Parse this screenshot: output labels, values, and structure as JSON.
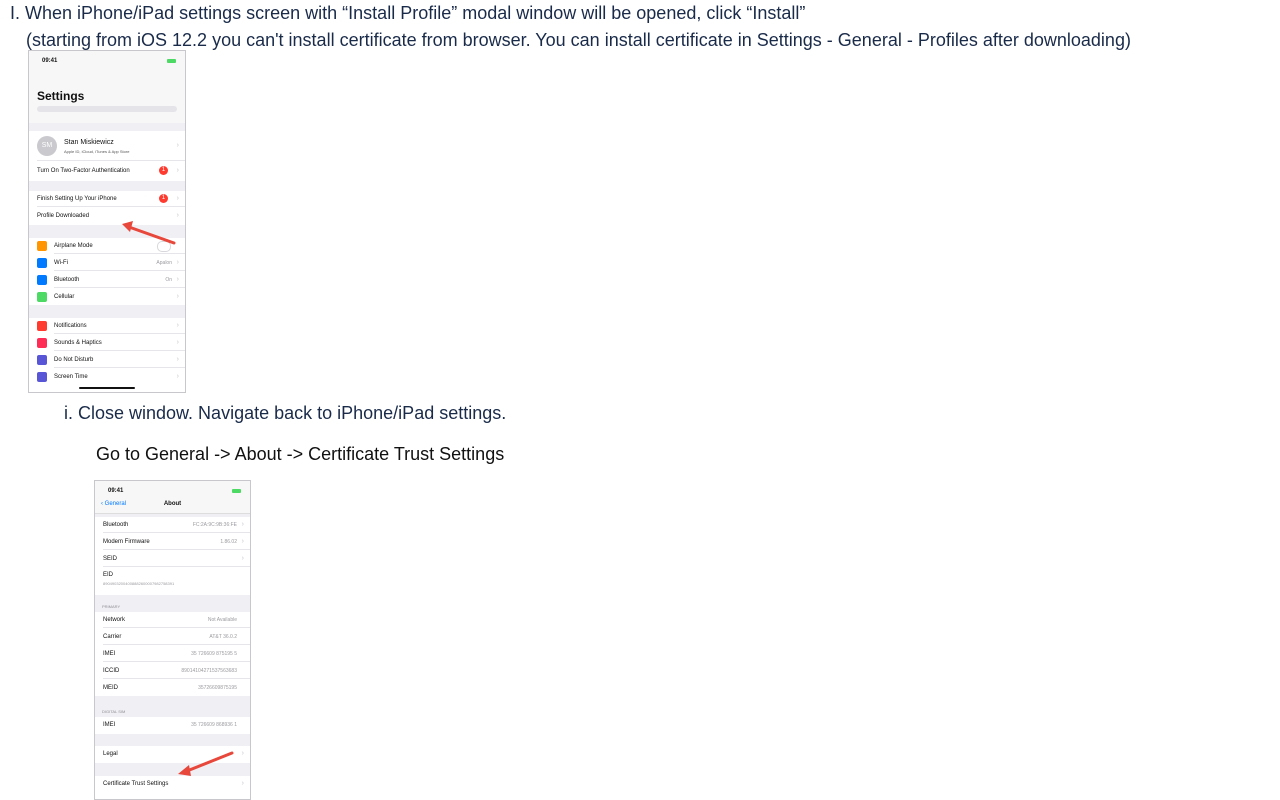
{
  "step1": "I. When iPhone/iPad settings screen with “Install Profile” modal window will be opened, click “Install”",
  "step1_note": "(starting from iOS 12.2 you can't install certificate from browser. You can install certificate in Settings - General - Profiles after downloading)",
  "step_i": "i. Close window. Navigate back to iPhone/iPad settings.",
  "goto": "Go to General -> About -> Certificate Trust Settings",
  "phone1": {
    "time": "09:41",
    "title": "Settings",
    "account": {
      "initials": "SM",
      "name": "Stan Miskiewicz",
      "subtitle": "Apple ID, iCloud, iTunes & App Store"
    },
    "two_factor": {
      "label": "Turn On Two-Factor Authentication",
      "badge": "1"
    },
    "finish": {
      "label": "Finish Setting Up Your iPhone",
      "badge": "1"
    },
    "profile": "Profile Downloaded",
    "rows_network": [
      {
        "label": "Airplane Mode",
        "value": "",
        "color": "#ff9500"
      },
      {
        "label": "Wi-Fi",
        "value": "Apalon",
        "color": "#007aff"
      },
      {
        "label": "Bluetooth",
        "value": "On",
        "color": "#007aff"
      },
      {
        "label": "Cellular",
        "value": "",
        "color": "#4cd964"
      }
    ],
    "rows_system": [
      {
        "label": "Notifications",
        "color": "#ff3b30"
      },
      {
        "label": "Sounds & Haptics",
        "color": "#ff2d55"
      },
      {
        "label": "Do Not Disturb",
        "color": "#5856d6"
      },
      {
        "label": "Screen Time",
        "color": "#5856d6"
      }
    ]
  },
  "phone2": {
    "time": "09:41",
    "back": "General",
    "title": "About",
    "rows_a": [
      {
        "label": "Bluetooth",
        "value": "FC:2A:9C:9B:36:FE"
      },
      {
        "label": "Modem Firmware",
        "value": "1.86.02"
      },
      {
        "label": "SEID",
        "value": ""
      }
    ],
    "eid_label": "EID",
    "eid_value": "89049032004008882600007982758391",
    "primary_header": "PRIMARY",
    "rows_primary": [
      {
        "label": "Network",
        "value": "Not Available"
      },
      {
        "label": "Carrier",
        "value": "AT&T 36.0.2"
      },
      {
        "label": "IMEI",
        "value": "35 726609 875195 5"
      },
      {
        "label": "ICCID",
        "value": "89014104271537563683"
      },
      {
        "label": "MEID",
        "value": "35726609875195"
      }
    ],
    "digital_header": "DIGITAL SIM",
    "rows_digital": [
      {
        "label": "IMEI",
        "value": "35 726609 868936 1"
      }
    ],
    "legal": "Legal",
    "cert": "Certificate Trust Settings"
  }
}
